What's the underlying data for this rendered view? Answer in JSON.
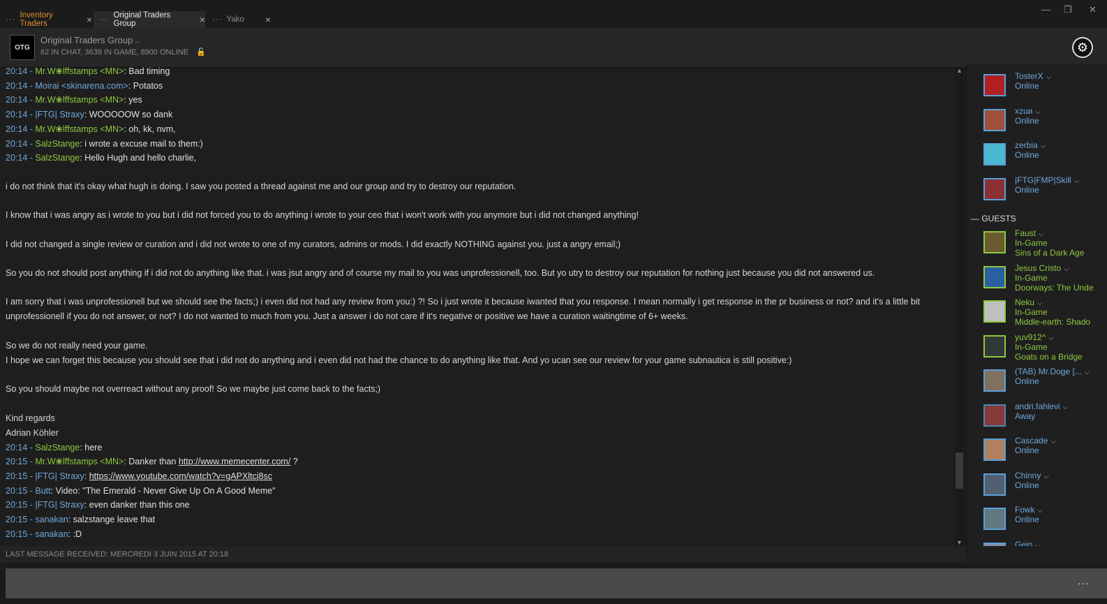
{
  "tabs": [
    {
      "label": "Inventory Traders"
    },
    {
      "label": "Original Traders Group"
    },
    {
      "label": "Yako"
    }
  ],
  "window": {
    "minimize": "—",
    "restore": "❐",
    "close": "✕"
  },
  "group": {
    "avatar_text": "OTG",
    "name": "Original Traders Group",
    "stats": "62 IN CHAT, 3639 IN GAME, 8900 ONLINE"
  },
  "chat": [
    {
      "ts": "20:14 - ",
      "user": "Mr.W❀lffstamps <MN>",
      "color": "green",
      "text": ": Bad timing"
    },
    {
      "ts": "20:14 - ",
      "user": "Moirai <skinarena.com>",
      "color": "blue",
      "text": ": Potatos"
    },
    {
      "ts": "20:14 - ",
      "user": "Mr.W❀lffstamps <MN>",
      "color": "green",
      "text": ": yes"
    },
    {
      "ts": "20:14 - ",
      "user": "|FTG| Straxy",
      "color": "blue",
      "text": ": WOOOOOW so dank"
    },
    {
      "ts": "20:14 - ",
      "user": "Mr.W❀lffstamps <MN>",
      "color": "green",
      "text": ": oh, kk, nvm,"
    },
    {
      "ts": "20:14 - ",
      "user": "SalzStange",
      "color": "green",
      "text": ": i wrote a excuse mail to them:)"
    },
    {
      "ts": "20:14 - ",
      "user": "SalzStange",
      "color": "green",
      "text": ": Hello Hugh and hello charlie,"
    }
  ],
  "letter": [
    "i do not think that it's okay what hugh is doing. I saw you posted a thread against me and our group and try to destroy our reputation.",
    "I know that i was angry as i wrote to you but i did not forced you to do anything i wrote to your ceo that i won't work with you anymore but i did not changed anything!",
    "I did not changed a single review or curation and i did not wrote to one of my curators, admins or mods. I did exactly NOTHING against you. just a angry email;)",
    "So you do not should post anything if i did not do anything like that. i was jsut angry and of course my mail to you was unprofessionell, too. But yo utry to destroy our reputation for nothing just because you did not answered us.",
    "I am sorry that i was unprofessionell but we should see the facts;) i even did not had any review from you:) ?! So i just wrote it because iwanted that you response. I mean normally i get response in the pr business or not? and it's a little bit unprofessionell if you do not answer, or not? I do not wanted to much from you. Just a answer i do not care if it's negative or positive we have a curation waitingtime of 6+ weeks.",
    "So we do not really need your game.",
    "I hope we can forget this because you should see that i did not do anything and i even did not had the chance to do anything like that. And yo ucan see our review for your game subnautica is still positive:)",
    "So you should maybe not overreact without any proof! So we maybe just come back to the facts;)",
    "Kind regards",
    "Adrian Köhler"
  ],
  "chat2": [
    {
      "ts": "20:14 - ",
      "user": "SalzStange",
      "color": "green",
      "text": ": here",
      "link": "",
      "after": ""
    },
    {
      "ts": "20:15 - ",
      "user": "Mr.W❀lffstamps <MN>",
      "color": "green",
      "text": ": Danker than ",
      "link": "http://www.memecenter.com/",
      "after": " ?"
    },
    {
      "ts": "20:15 - ",
      "user": "|FTG| Straxy",
      "color": "blue",
      "text": ": ",
      "link": "https://www.youtube.com/watch?v=gAPXltcj8sc",
      "after": ""
    },
    {
      "ts": "20:15 - ",
      "user": "Butt",
      "color": "blue",
      "text": ": Video: \"The Emerald - Never Give Up On A Good Meme\"",
      "link": "",
      "after": ""
    },
    {
      "ts": "20:15 - ",
      "user": "|FTG| Straxy",
      "color": "blue",
      "text": ": even danker than this one",
      "link": "",
      "after": ""
    },
    {
      "ts": "20:15 - ",
      "user": "sanakan",
      "color": "blue",
      "text": ": salzstange leave that",
      "link": "",
      "after": ""
    },
    {
      "ts": "20:15 - ",
      "user": "sanakan",
      "color": "blue",
      "text": ": :D",
      "link": "",
      "after": ""
    }
  ],
  "status_bar": "LAST MESSAGE RECEIVED: MERCREDI 3 JUIN 2015 AT 20:18",
  "input_more": "...",
  "members": [
    {
      "name": "TosterX",
      "status": "Online",
      "game": "",
      "state": "online",
      "color": "#b02020"
    },
    {
      "name": "хzuи",
      "status": "Online",
      "game": "",
      "state": "online",
      "color": "#a0503a"
    },
    {
      "name": "zerbia",
      "status": "Online",
      "game": "",
      "state": "online",
      "color": "#4ab8d0"
    },
    {
      "name": "|FTG|FMP|Skill",
      "status": "Online",
      "game": "",
      "state": "online",
      "color": "#8a3030"
    }
  ],
  "guests_label": "GUESTS",
  "guests": [
    {
      "name": "Faust",
      "status": "In-Game",
      "game": "Sins of a Dark Age",
      "state": "ingame",
      "color": "#6a5a30"
    },
    {
      "name": "Jesus Cristo",
      "status": "In-Game",
      "game": "Doorways: The Unde",
      "state": "ingame",
      "color": "#2a60a0"
    },
    {
      "name": "Neku",
      "status": "In-Game",
      "game": "Middle-earth: Shado",
      "state": "ingame",
      "color": "#c0c0c0"
    },
    {
      "name": "yuv912^",
      "status": "In-Game",
      "game": "Goats on a Bridge",
      "state": "ingame",
      "color": "#303838"
    },
    {
      "name": "(TAB) Mr.Doge [...",
      "status": "Online",
      "game": "",
      "state": "online",
      "color": "#807060"
    },
    {
      "name": "andri.fahlevi",
      "status": "Away",
      "game": "",
      "state": "away",
      "color": "#a04040"
    },
    {
      "name": "Cascade",
      "status": "Online",
      "game": "",
      "state": "online",
      "color": "#b08060"
    },
    {
      "name": "Chinny",
      "status": "Online",
      "game": "",
      "state": "online",
      "color": "#506070"
    },
    {
      "name": "Fowk",
      "status": "Online",
      "game": "",
      "state": "online",
      "color": "#607880"
    },
    {
      "name": "Gein",
      "status": "",
      "game": "",
      "state": "online",
      "color": "#8090a0"
    }
  ]
}
